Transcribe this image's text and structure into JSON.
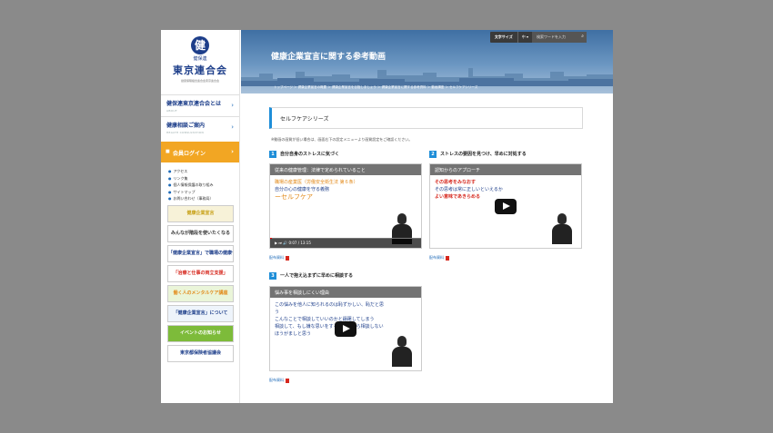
{
  "sidebar": {
    "logo": {
      "emblem": "健",
      "kenpo": "健保連",
      "title": "東京連合会",
      "subtitle": "健康保険組合連合会東京連合会"
    },
    "nav": [
      {
        "label": "健保連東京連合会とは",
        "sub": "ABOUT"
      },
      {
        "label": "健康相談ご案内",
        "sub": "HEALTH CONSULTATION"
      }
    ],
    "login": "会員ログイン",
    "links": [
      "アクセス",
      "リンク集",
      "個人情報保護の取り組み",
      "サイトマップ",
      "お問い合わせ（事務局）"
    ],
    "banners": [
      {
        "label": "健康企業宣言",
        "color": "#c8a21a",
        "bg": "#f7f2d8"
      },
      {
        "label": "みんなが階段を使いたくなる",
        "color": "#333",
        "bg": "#fff"
      },
      {
        "label": "「健康企業宣言」で職場の健康づくりを！",
        "color": "#1d3e8a",
        "bg": "#fff"
      },
      {
        "label": "「治療と仕事の両立支援」",
        "color": "#d6281e",
        "bg": "#fff"
      },
      {
        "label": "働く人のメンタルケア講座",
        "color": "#e28a1a",
        "bg": "#eaf5d9"
      },
      {
        "label": "「健康企業宣言」について",
        "color": "#1d3e8a",
        "bg": "#eef4fb"
      },
      {
        "label": "イベントのお知らせ",
        "color": "#fff",
        "bg": "#7dbb3a"
      },
      {
        "label": "東京都保険者協議会",
        "color": "#1d3e8a",
        "bg": "#fff"
      }
    ]
  },
  "header": {
    "title": "健康企業宣言に関する参考動画",
    "breadcrumb": "トップページ ＞ 健康企業宣言の概要 ＞ 健康企業宣言を目指しましょう ＞ 健康企業宣言に関する参考資料 ＞ 動画講座 ＞ セルフケアシリーズ",
    "font_size_label": "文字サイズ",
    "font_size_value": "中",
    "search_placeholder": "検索ワードを入力"
  },
  "main": {
    "section_title": "セルフケアシリーズ",
    "note": "※動画の画質が低い場合は、画面右下の設定メニューより画質設定をご確認ください。",
    "videos": [
      {
        "num": "1",
        "label": "自分自身のストレスに気づく",
        "top_text": "従来の健康管理：法律で定められていること",
        "lines": [
          "職場の産業医（労働安全衛生法 第６条）",
          "自分の心の健康を守る義務",
          "ーセルフケア"
        ],
        "time": "0:07 / 13:15",
        "progress": 0.01,
        "material": "配布資料"
      },
      {
        "num": "2",
        "label": "ストレスの要因を見つけ、早めに対処する",
        "top_text": "認知からのアプローチ",
        "lines": [
          "その思考をみなおす",
          "その思考は常に正しいといえるか",
          "よい意味であきらめる"
        ],
        "time": "",
        "progress": 0,
        "material": "配布資料"
      },
      {
        "num": "3",
        "label": "一人で抱え込まずに早めに相談する",
        "top_text": "悩み事を相談しにくい理由",
        "lines": [
          "この悩みを他人に知られるのは恥ずかしい、恥だと思う",
          "こんなことで相談していいのかと躊躇してしまう",
          "相談して、もし嫌な思いをするぐらいなら相談しないほうがましと思う"
        ],
        "time": "",
        "progress": 0,
        "material": "配布資料"
      }
    ]
  },
  "colors": {
    "accent": "#1f8ed8",
    "brand": "#1d3e8a",
    "login": "#f2a623"
  }
}
